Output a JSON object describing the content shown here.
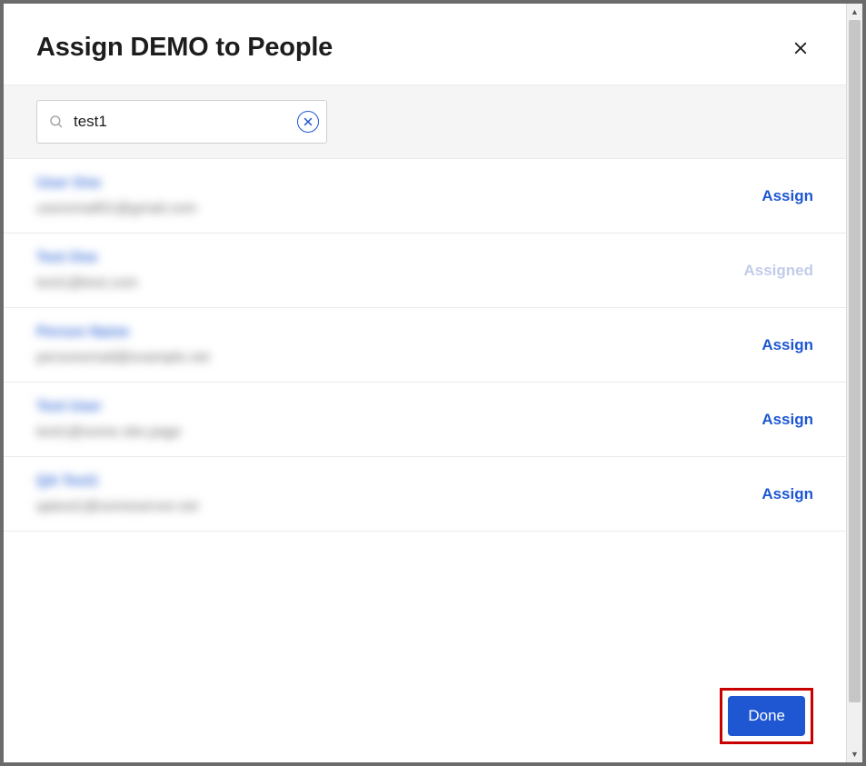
{
  "header": {
    "title": "Assign DEMO to People"
  },
  "search": {
    "value": "test1",
    "placeholder": "Search"
  },
  "actions": {
    "assign_label": "Assign",
    "assigned_label": "Assigned",
    "done_label": "Done"
  },
  "people": [
    {
      "name": "User One",
      "email": "useremail01@gmail.com",
      "assigned": false
    },
    {
      "name": "Test One",
      "email": "test1@test.com",
      "assigned": true
    },
    {
      "name": "Person Name",
      "email": "personemail@example.net",
      "assigned": false
    },
    {
      "name": "Test User",
      "email": "test1@some.site.page",
      "assigned": false
    },
    {
      "name": "QA Test1",
      "email": "qatest1@someserver.net",
      "assigned": false
    }
  ]
}
